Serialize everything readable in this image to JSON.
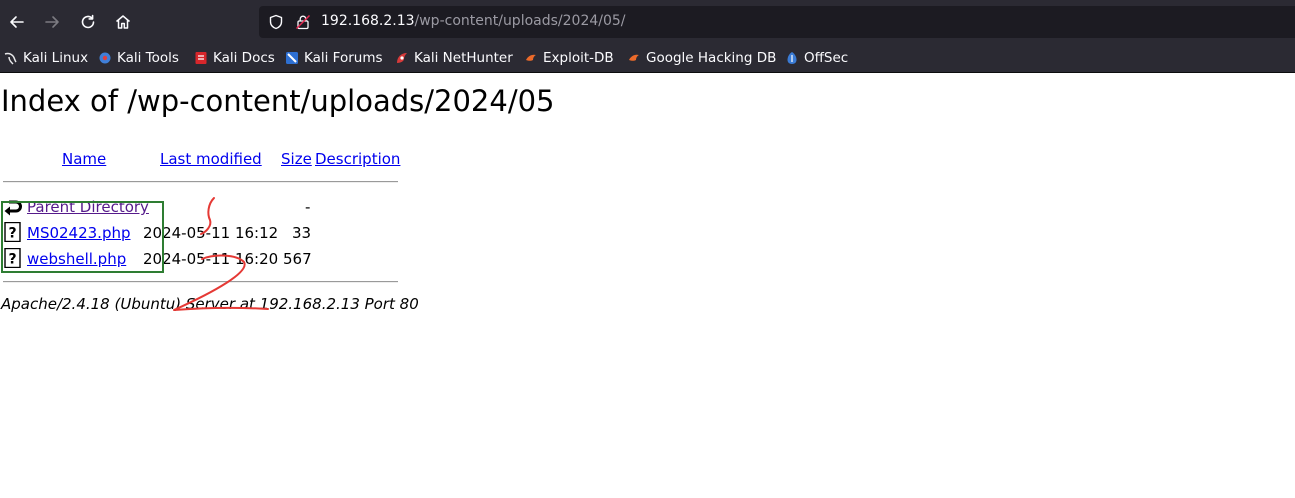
{
  "browser": {
    "url_host": "192.168.2.13",
    "url_path": "/wp-content/uploads/2024/05/",
    "bookmarks": [
      {
        "label": "Kali Linux",
        "icon": "kali-dragon-icon"
      },
      {
        "label": "Kali Tools",
        "icon": "kali-tools-icon"
      },
      {
        "label": "Kali Docs",
        "icon": "kali-docs-icon"
      },
      {
        "label": "Kali Forums",
        "icon": "kali-forums-icon"
      },
      {
        "label": "Kali NetHunter",
        "icon": "kali-nethunter-icon"
      },
      {
        "label": "Exploit-DB",
        "icon": "exploit-db-icon"
      },
      {
        "label": "Google Hacking DB",
        "icon": "google-hacking-db-icon"
      },
      {
        "label": "OffSec",
        "icon": "offsec-icon"
      }
    ],
    "colors": {
      "chrome": "#2b2a33",
      "urlbar": "#1c1b22",
      "link": "#0000ee",
      "visited": "#551a8b",
      "annotation_box": "#2e7d32",
      "annotation_scribble": "#e53935"
    }
  },
  "listing": {
    "title": "Index of /wp-content/uploads/2024/05",
    "headers": {
      "name": "Name",
      "last_modified": "Last modified",
      "size": "Size",
      "description": "Description"
    },
    "parent": {
      "name": "Parent Directory",
      "size": "-",
      "icon": "back-arrow-icon"
    },
    "files": [
      {
        "name": "MS02423.php",
        "modified": "2024-05-11 16:12",
        "size": "33",
        "icon": "unknown-file-icon"
      },
      {
        "name": "webshell.php",
        "modified": "2024-05-11 16:20",
        "size": "567",
        "icon": "unknown-file-icon"
      }
    ],
    "address": "Apache/2.4.18 (Ubuntu) Server at 192.168.2.13 Port 80"
  }
}
